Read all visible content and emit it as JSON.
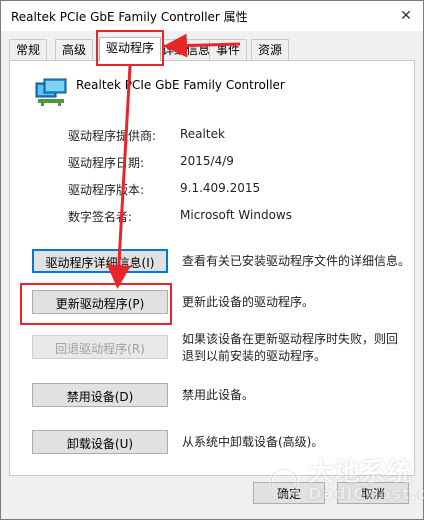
{
  "window": {
    "title": "Realtek PCIe GbE Family Controller 属性",
    "close_glyph": "✕"
  },
  "tabs": [
    {
      "label": "常规"
    },
    {
      "label": "高级"
    },
    {
      "label": "驱动程序"
    },
    {
      "label": "详细信息"
    },
    {
      "label": "事件"
    },
    {
      "label": "资源"
    }
  ],
  "device": {
    "name": "Realtek PCIe GbE Family Controller",
    "icon": "network-adapter-icon"
  },
  "properties": [
    {
      "label": "驱动程序提供商:",
      "value": "Realtek"
    },
    {
      "label": "驱动程序日期:",
      "value": "2015/4/9"
    },
    {
      "label": "驱动程序版本:",
      "value": "9.1.409.2015"
    },
    {
      "label": "数字签名者:",
      "value": "Microsoft Windows"
    }
  ],
  "actions": [
    {
      "button": "驱动程序详细信息(I)",
      "description": "查看有关已安装驱动程序文件的详细信息。",
      "enabled": true
    },
    {
      "button": "更新驱动程序(P)",
      "description": "更新此设备的驱动程序。",
      "enabled": true
    },
    {
      "button": "回退驱动程序(R)",
      "description": "如果该设备在更新驱动程序时失败，则回退到以前安装的驱动程序。",
      "enabled": false
    },
    {
      "button": "禁用设备(D)",
      "description": "禁用此设备。",
      "enabled": true
    },
    {
      "button": "卸载设备(U)",
      "description": "从系统中卸载设备(高级)。",
      "enabled": true
    }
  ],
  "footer": {
    "ok": "确定",
    "cancel": "取消"
  },
  "annotation_color": "#e8262a",
  "watermark": {
    "brand": "大地系统",
    "domain": "DadiGhost.com"
  }
}
